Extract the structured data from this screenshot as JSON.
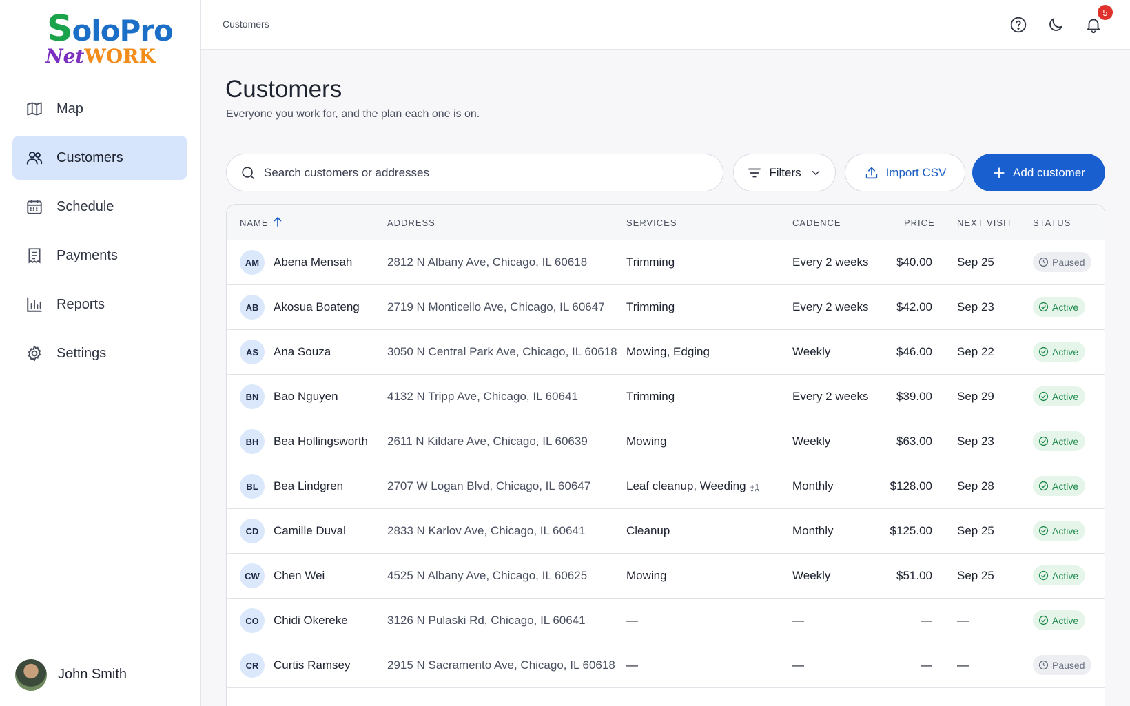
{
  "brand": {
    "logo_line1_first": "S",
    "logo_line1_rest": "oloPro",
    "logo_net": "Net",
    "logo_work": "WORK"
  },
  "sidebar": {
    "items": [
      {
        "label": "Map",
        "icon": "map-icon"
      },
      {
        "label": "Customers",
        "icon": "users-icon",
        "active": true
      },
      {
        "label": "Schedule",
        "icon": "calendar-icon"
      },
      {
        "label": "Payments",
        "icon": "receipt-icon"
      },
      {
        "label": "Reports",
        "icon": "bar-chart-icon"
      },
      {
        "label": "Settings",
        "icon": "gear-icon"
      }
    ],
    "user": {
      "name": "John Smith"
    }
  },
  "topbar": {
    "breadcrumb": "Customers",
    "notifications_count": "5"
  },
  "page": {
    "title": "Customers",
    "subtitle": "Everyone you work for, and the plan each one is on."
  },
  "toolbar": {
    "search_placeholder": "Search customers or addresses",
    "filters_label": "Filters",
    "import_label": "Import CSV",
    "add_label": "Add customer"
  },
  "table": {
    "columns": {
      "name": "NAME",
      "address": "ADDRESS",
      "services": "SERVICES",
      "cadence": "CADENCE",
      "price": "PRICE",
      "next_visit": "NEXT VISIT",
      "status": "STATUS"
    },
    "rows": [
      {
        "initials": "AM",
        "name": "Abena Mensah",
        "address": "2812 N Albany Ave, Chicago, IL 60618",
        "services": "Trimming",
        "more": "",
        "cadence": "Every 2 weeks",
        "price": "$40.00",
        "next": "Sep 25",
        "status": "Paused"
      },
      {
        "initials": "AB",
        "name": "Akosua Boateng",
        "address": "2719 N Monticello Ave, Chicago, IL 60647",
        "services": "Trimming",
        "more": "",
        "cadence": "Every 2 weeks",
        "price": "$42.00",
        "next": "Sep 23",
        "status": "Active"
      },
      {
        "initials": "AS",
        "name": "Ana Souza",
        "address": "3050 N Central Park Ave, Chicago, IL 60618",
        "services": "Mowing, Edging",
        "more": "",
        "cadence": "Weekly",
        "price": "$46.00",
        "next": "Sep 22",
        "status": "Active"
      },
      {
        "initials": "BN",
        "name": "Bao Nguyen",
        "address": "4132 N Tripp Ave, Chicago, IL 60641",
        "services": "Trimming",
        "more": "",
        "cadence": "Every 2 weeks",
        "price": "$39.00",
        "next": "Sep 29",
        "status": "Active"
      },
      {
        "initials": "BH",
        "name": "Bea Hollingsworth",
        "address": "2611 N Kildare Ave, Chicago, IL 60639",
        "services": "Mowing",
        "more": "",
        "cadence": "Weekly",
        "price": "$63.00",
        "next": "Sep 23",
        "status": "Active"
      },
      {
        "initials": "BL",
        "name": "Bea Lindgren",
        "address": "2707 W Logan Blvd, Chicago, IL 60647",
        "services": "Leaf cleanup, Weeding",
        "more": "+1",
        "cadence": "Monthly",
        "price": "$128.00",
        "next": "Sep 28",
        "status": "Active"
      },
      {
        "initials": "CD",
        "name": "Camille Duval",
        "address": "2833 N Karlov Ave, Chicago, IL 60641",
        "services": "Cleanup",
        "more": "",
        "cadence": "Monthly",
        "price": "$125.00",
        "next": "Sep 25",
        "status": "Active"
      },
      {
        "initials": "CW",
        "name": "Chen Wei",
        "address": "4525 N Albany Ave, Chicago, IL 60625",
        "services": "Mowing",
        "more": "",
        "cadence": "Weekly",
        "price": "$51.00",
        "next": "Sep 25",
        "status": "Active"
      },
      {
        "initials": "CO",
        "name": "Chidi Okereke",
        "address": "3126 N Pulaski Rd, Chicago, IL 60641",
        "services": "—",
        "more": "",
        "cadence": "—",
        "price": "—",
        "next": "—",
        "status": "Active"
      },
      {
        "initials": "CR",
        "name": "Curtis Ramsey",
        "address": "2915 N Sacramento Ave, Chicago, IL 60618",
        "services": "—",
        "more": "",
        "cadence": "—",
        "price": "—",
        "next": "—",
        "status": "Paused"
      }
    ]
  },
  "colors": {
    "accent": "#1a5fd0",
    "active_bg": "#d6e5fb",
    "status_active": "#1f8a4c",
    "status_paused": "#6a7080",
    "badge": "#e0322c"
  }
}
